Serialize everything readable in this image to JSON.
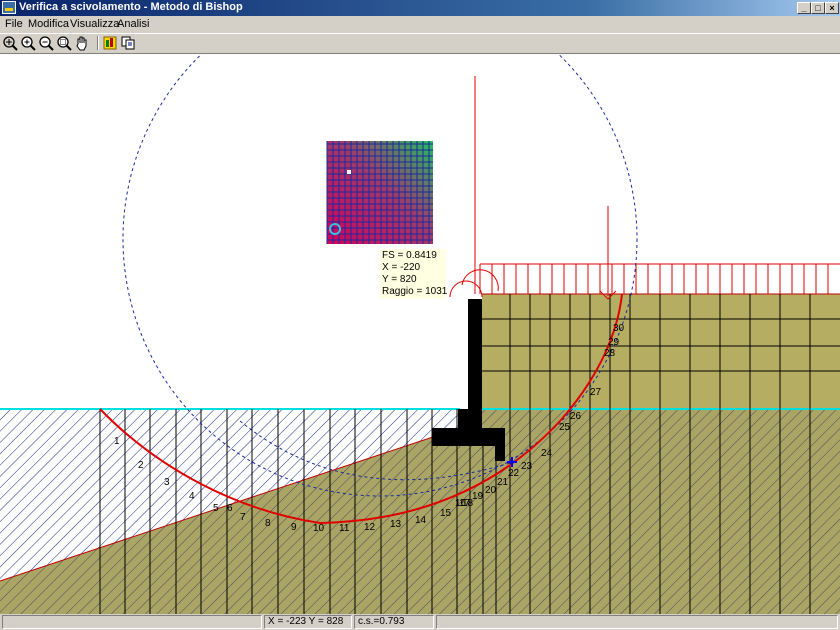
{
  "window": {
    "title": "Verifica a scivolamento - Metodo di Bishop"
  },
  "menu": [
    {
      "label": "File"
    },
    {
      "label": "Modifica"
    },
    {
      "label": "Visualizza"
    },
    {
      "label": "Analisi"
    }
  ],
  "toolbar": [
    {
      "icon": "zoom-fit-icon"
    },
    {
      "icon": "zoom-in-icon"
    },
    {
      "icon": "zoom-out-icon"
    },
    {
      "icon": "zoom-window-icon"
    },
    {
      "icon": "pan-hand-icon"
    },
    {
      "icon": "run-analysis-icon"
    },
    {
      "icon": "copy-icon"
    }
  ],
  "result": {
    "fs": "FS = 0.8419",
    "x": "X = -220",
    "y": "Y = 820",
    "raggio": "Raggio = 1031"
  },
  "slice_labels": [
    "1",
    "2",
    "3",
    "4",
    "5",
    "6",
    "7",
    "8",
    "9",
    "10",
    "11",
    "12",
    "13",
    "14",
    "15",
    "16",
    "17",
    "18",
    "19",
    "20",
    "21",
    "22",
    "23",
    "24",
    "25",
    "26",
    "27",
    "28",
    "29",
    "30"
  ],
  "status": {
    "coords": "X = -223  Y = 828",
    "cs": "c.s.=0.793"
  },
  "colors": {
    "title_bar": "#0a246a",
    "slip_surface": "#ff0000",
    "soil": "#b5ae62",
    "grid_circle": "#000080",
    "water_table": "#00e0e0"
  }
}
